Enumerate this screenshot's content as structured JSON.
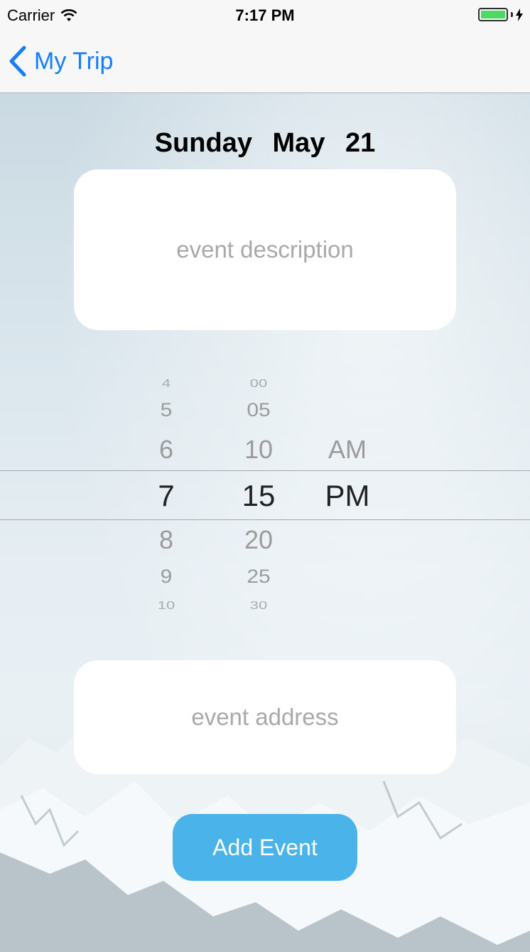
{
  "status_bar": {
    "carrier": "Carrier",
    "time": "7:17 PM",
    "battery_color": "#4cd964"
  },
  "nav": {
    "back_label": "My Trip",
    "back_icon": "chevron-left-icon",
    "accent": "#157efb"
  },
  "date_title": "Sunday   May 21",
  "description_field": {
    "placeholder": "event description",
    "value": ""
  },
  "time_picker": {
    "hours": [
      "4",
      "5",
      "6",
      "7",
      "8",
      "9",
      "10"
    ],
    "minutes": [
      "00",
      "05",
      "10",
      "15",
      "20",
      "25",
      "30"
    ],
    "meridiem": [
      "AM",
      "PM"
    ],
    "selected": {
      "hour": "7",
      "minute": "15",
      "meridiem": "PM"
    }
  },
  "address_field": {
    "placeholder": "event address",
    "value": ""
  },
  "add_button": {
    "label": "Add Event",
    "color": "#4ab3ea"
  }
}
